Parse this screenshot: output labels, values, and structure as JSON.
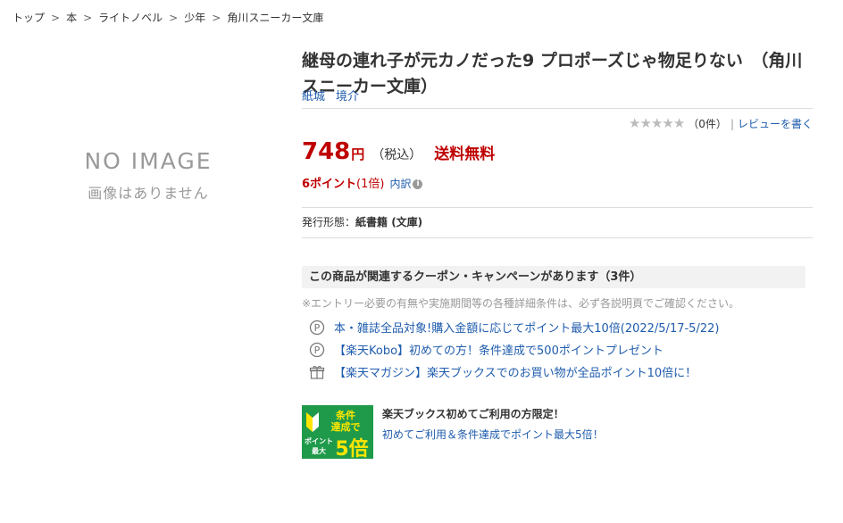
{
  "breadcrumb": {
    "items": [
      "トップ",
      "本",
      "ライトノベル",
      "少年",
      "角川スニーカー文庫"
    ],
    "separator": ">"
  },
  "image_placeholder": {
    "line1": "NO IMAGE",
    "line2": "画像はありません"
  },
  "product": {
    "title": "継母の連れ子が元カノだった9 プロポーズじゃ物足りない　（角川スニーカー文庫）",
    "authors": [
      "紙城",
      "境介"
    ]
  },
  "rating": {
    "stars": "★★★★★",
    "count": "（0件）",
    "pipe": "|",
    "write_review": "レビューを書く"
  },
  "price": {
    "amount": "748",
    "unit": "円",
    "tax": "（税込）",
    "shipping": "送料無料"
  },
  "points": {
    "label": "6ポイント",
    "multiplier": "(1倍)",
    "breakdown": "内訳",
    "info_icon": "i"
  },
  "format": {
    "label": "発行形態：",
    "value": "紙書籍 (文庫)"
  },
  "campaigns": {
    "heading": "この商品が関連するクーポン・キャンペーンがあります（3件）",
    "note": "※エントリー必要の有無や実施期間等の各種詳細条件は、必ず各説明頁でご確認ください。",
    "items": [
      {
        "icon": "point-icon",
        "text": "本・雑誌全品対象!購入金額に応じてポイント最大10倍(2022/5/17-5/22)"
      },
      {
        "icon": "point-icon",
        "text": "【楽天Kobo】初めての方！条件達成で500ポイントプレゼント"
      },
      {
        "icon": "gift-icon",
        "text": "【楽天マガジン】楽天ブックスでのお買い物が全品ポイント10倍に！"
      }
    ]
  },
  "promo": {
    "badge": {
      "line1": "条件",
      "line2": "達成で",
      "line3": "ポイント",
      "line4": "最大",
      "big": "5倍"
    },
    "title": "楽天ブックス初めてご利用の方限定！",
    "link": "初めてご利用＆条件達成でポイント最大5倍！"
  },
  "colors": {
    "price_red": "#bf0000",
    "link_blue": "#1f5cad",
    "badge_green": "#1f9a4a",
    "badge_yellow": "#ffe600"
  }
}
